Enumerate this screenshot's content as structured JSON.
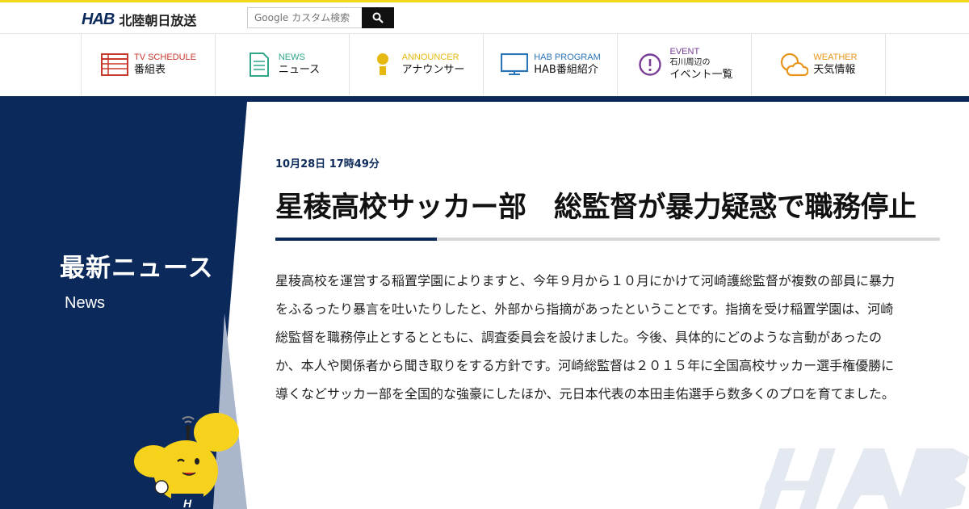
{
  "header": {
    "logo_mark": "HAB",
    "logo_text": "北陸朝日放送",
    "search_placeholder": "Google カスタム検索"
  },
  "nav": [
    {
      "en": "TV SCHEDULE",
      "jp": "番組表",
      "icon": "tv-schedule-icon",
      "color": "#c9382c"
    },
    {
      "en": "NEWS",
      "jp": "ニュース",
      "icon": "news-icon",
      "color": "#2fa58a"
    },
    {
      "en": "ANNOUNCER",
      "jp": "アナウンサー",
      "icon": "announcer-icon",
      "color": "#e5b911"
    },
    {
      "en": "HAB PROGRAM",
      "jp": "HAB番組紹介",
      "icon": "program-icon",
      "color": "#2a74b8"
    },
    {
      "en": "EVENT",
      "jp_small": "石川周辺の",
      "jp": "イベント一覧",
      "icon": "event-icon",
      "color": "#7a3d96"
    },
    {
      "en": "WEATHER",
      "jp": "天気情報",
      "icon": "weather-icon",
      "color": "#e8941a"
    }
  ],
  "sidebar": {
    "title": "最新ニュース",
    "subtitle": "News"
  },
  "article": {
    "date": "10月28日 17時49分",
    "headline": "星稜高校サッカー部　総監督が暴力疑惑で職務停止",
    "body": "星稜高校を運営する稲置学園によりますと、今年９月から１０月にかけて河崎護総監督が複数の部員に暴力をふるったり暴言を吐いたりしたと、外部から指摘があったということです。指摘を受け稲置学園は、河崎総監督を職務停止とするとともに、調査委員会を設けました。今後、具体的にどのような言動があったのか、本人や関係者から聞き取りをする方針です。河崎総監督は２０１５年に全国高校サッカー選手権優勝に導くなどサッカー部を全国的な強豪にしたほか、元日本代表の本田圭佑選手ら数多くのプロを育てました。"
  },
  "colors": {
    "navy": "#0b2a5b",
    "accent_yellow": "#f2d91a",
    "mascot_yellow": "#f7d21c"
  }
}
